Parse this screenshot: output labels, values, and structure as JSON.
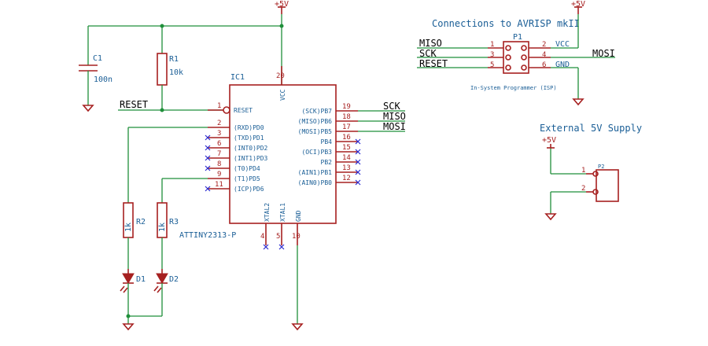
{
  "power": {
    "vcc_label": "+5V"
  },
  "ic": {
    "ref": "IC1",
    "part": "ATTINY2313-P",
    "pins": [
      {
        "num": "1",
        "name": "RESET"
      },
      {
        "num": "2",
        "name": "(RXD)PD0"
      },
      {
        "num": "3",
        "name": "(TXD)PD1"
      },
      {
        "num": "6",
        "name": "(INT0)PD2"
      },
      {
        "num": "7",
        "name": "(INT1)PD3"
      },
      {
        "num": "8",
        "name": "(T0)PD4"
      },
      {
        "num": "9",
        "name": "(T1)PD5"
      },
      {
        "num": "11",
        "name": "(ICP)PD6"
      },
      {
        "num": "19",
        "name": "(SCK)PB7"
      },
      {
        "num": "18",
        "name": "(MISO)PB6"
      },
      {
        "num": "17",
        "name": "(MOSI)PB5"
      },
      {
        "num": "16",
        "name": "PB4"
      },
      {
        "num": "15",
        "name": "(OCI)PB3"
      },
      {
        "num": "14",
        "name": "PB2"
      },
      {
        "num": "13",
        "name": "(AIN1)PB1"
      },
      {
        "num": "12",
        "name": "(AIN0)PB0"
      },
      {
        "num": "20",
        "name": "VCC"
      },
      {
        "num": "4",
        "name": "XTAL2"
      },
      {
        "num": "5",
        "name": "XTAL1"
      },
      {
        "num": "10",
        "name": "GND"
      }
    ]
  },
  "components": {
    "c1": {
      "ref": "C1",
      "value": "100n"
    },
    "r1": {
      "ref": "R1",
      "value": "10k"
    },
    "r2": {
      "ref": "R2",
      "value": "1k"
    },
    "r3": {
      "ref": "R3",
      "value": "1k"
    },
    "d1": {
      "ref": "D1"
    },
    "d2": {
      "ref": "D2"
    }
  },
  "nets": {
    "reset": "RESET",
    "sck": "SCK",
    "miso": "MISO",
    "mosi": "MOSI"
  },
  "isp": {
    "title": "Connections to AVRISP mkII",
    "ref": "P1",
    "subtitle": "In-System Programmer (ISP)",
    "left_signals": [
      "MISO",
      "SCK",
      "RESET"
    ],
    "left_pins": [
      "1",
      "3",
      "5"
    ],
    "right_pins": [
      "2",
      "4",
      "6"
    ],
    "right_signals": [
      "VCC",
      "MOSI",
      "GND"
    ]
  },
  "supply": {
    "title": "External 5V Supply",
    "ref": "P2",
    "pins": [
      "1",
      "2"
    ]
  },
  "colors": {
    "wire": "#1f8f3a",
    "part": "#a62020",
    "label": "#1a5e96",
    "no_connect": "#2a2ad0"
  }
}
